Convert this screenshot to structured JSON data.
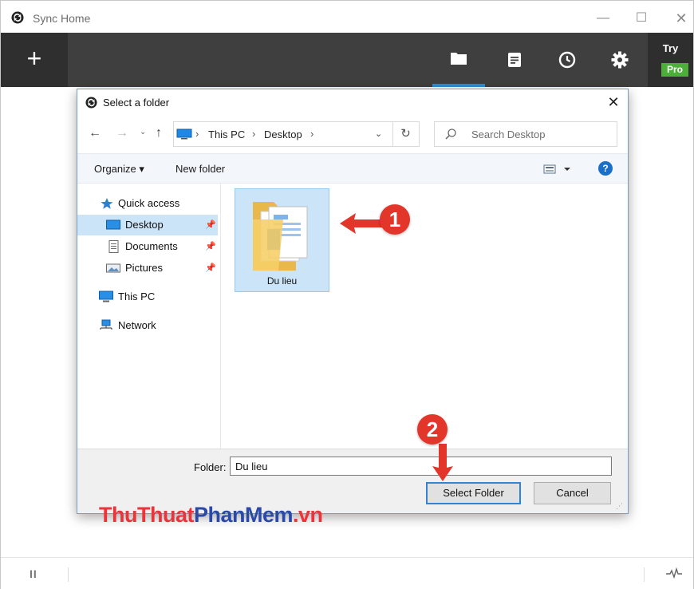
{
  "app": {
    "title": "Sync Home",
    "window_min": "—",
    "window_max": "☐",
    "window_close": "✕",
    "add_label": "+",
    "try_label": "Try",
    "pro_badge": "Pro"
  },
  "dialog": {
    "title": "Select a folder",
    "close_label": "✕",
    "breadcrumb": [
      "This PC",
      "Desktop"
    ],
    "search_placeholder": "Search Desktop",
    "organize_label": "Organize ▾",
    "new_folder_label": "New folder",
    "help_label": "?",
    "nav_items": [
      {
        "label": "Quick access",
        "icon": "star-icon"
      },
      {
        "label": "Desktop",
        "icon": "desktop-icon",
        "selected": true,
        "pinned": true
      },
      {
        "label": "Documents",
        "icon": "document-icon",
        "pinned": true
      },
      {
        "label": "Pictures",
        "icon": "pictures-icon",
        "pinned": true
      },
      {
        "label": "This PC",
        "icon": "computer-icon"
      },
      {
        "label": "Network",
        "icon": "network-icon"
      }
    ],
    "files": [
      {
        "name": "Du lieu",
        "icon": "folder-icon",
        "selected": true
      }
    ],
    "folder_label": "Folder:",
    "folder_value": "Du lieu",
    "select_button": "Select Folder",
    "cancel_button": "Cancel"
  },
  "annotations": {
    "step1": "1",
    "step2": "2"
  },
  "watermark": {
    "part1": "ThuThuat",
    "part2": "PhanMem",
    "part3": ".vn"
  },
  "colors": {
    "toolbar_bg": "#3f3f3f",
    "accent": "#2a8fd8",
    "pro_green": "#4caf3a",
    "annotation_red": "#e2362b",
    "selection_blue": "#cce4f7"
  }
}
